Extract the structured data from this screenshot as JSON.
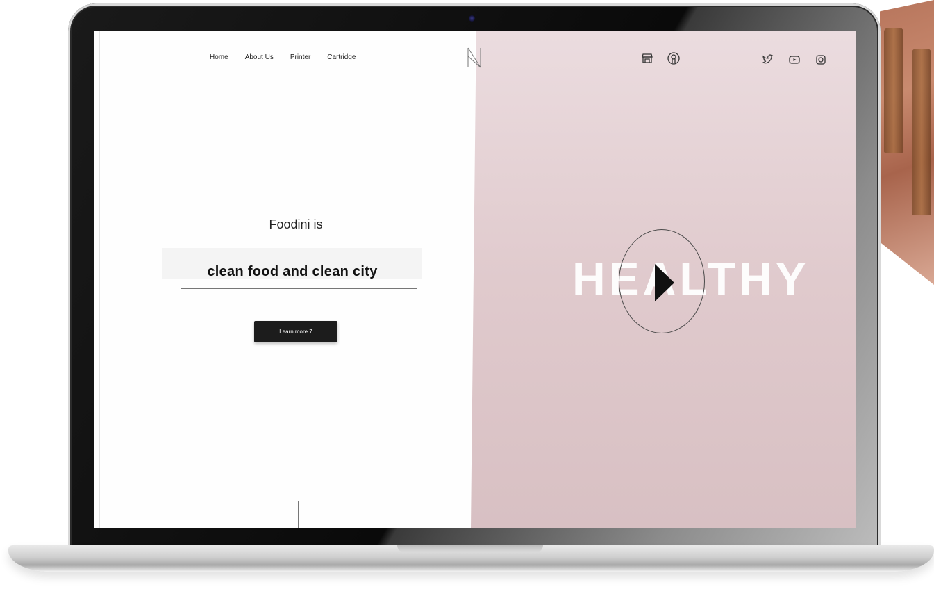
{
  "nav": {
    "items": [
      {
        "label": "Home",
        "active": true
      },
      {
        "label": "About Us",
        "active": false
      },
      {
        "label": "Printer",
        "active": false
      },
      {
        "label": "Cartridge",
        "active": false
      }
    ]
  },
  "header": {
    "logo_icon": "n-monogram-logo",
    "shop_icons": [
      "store-icon",
      "account-icon"
    ],
    "social_icons": [
      "twitter-icon",
      "youtube-icon",
      "instagram-icon"
    ]
  },
  "hero": {
    "kicker": "Foodini is",
    "headline": "clean food and clean city",
    "cta_label": "Learn more 7"
  },
  "video": {
    "overlay_text": "HEALTHY",
    "play_icon": "play-icon"
  },
  "colors": {
    "accent": "#e7855a",
    "button_bg": "#1c1c1c",
    "video_bg": "#e0cacd"
  }
}
